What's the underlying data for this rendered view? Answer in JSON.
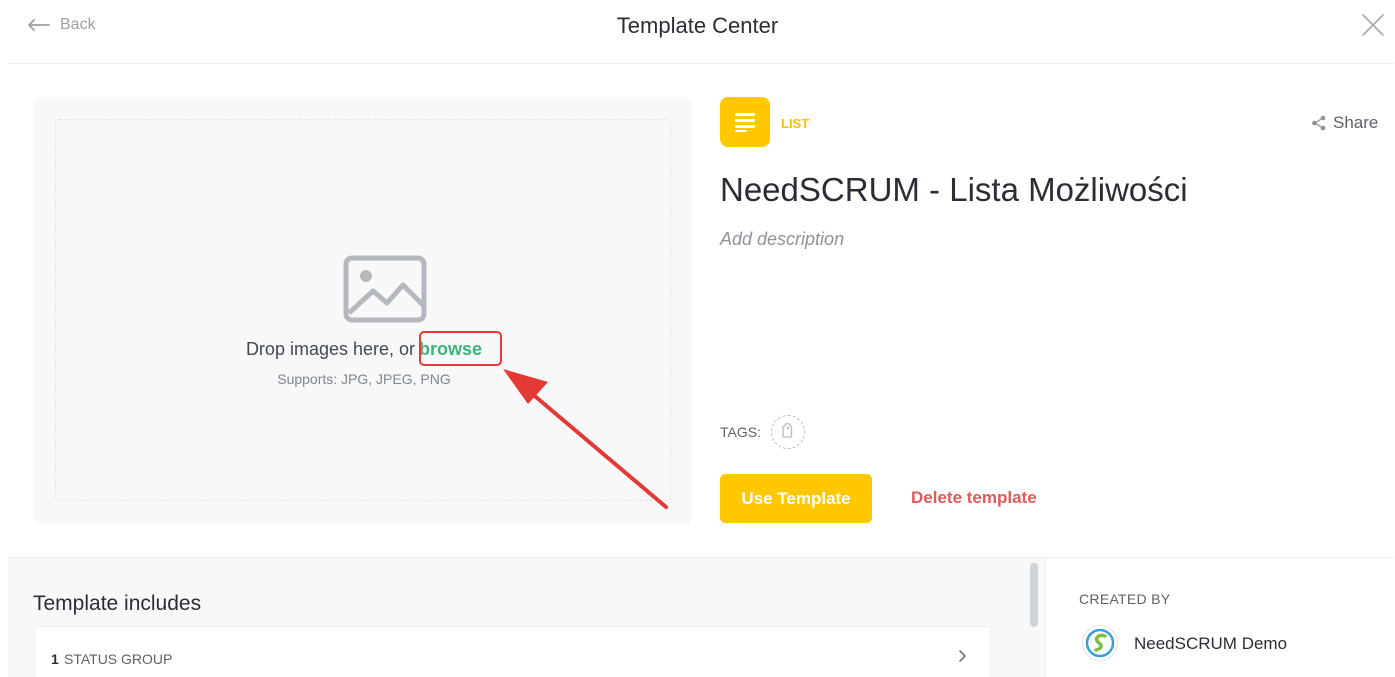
{
  "header": {
    "back_label": "Back",
    "title": "Template Center"
  },
  "dropzone": {
    "prompt": "Drop images here, or",
    "browse_label": "browse",
    "supports": "Supports: JPG, JPEG, PNG"
  },
  "template": {
    "type_label": "LIST",
    "name": "NeedSCRUM - Lista Możliwości",
    "description_placeholder": "Add description",
    "share_label": "Share",
    "tags_label": "TAGS:"
  },
  "actions": {
    "use_label": "Use Template",
    "delete_label": "Delete template"
  },
  "includes": {
    "title": "Template includes",
    "items": [
      {
        "count": "1",
        "label": "STATUS GROUP"
      }
    ]
  },
  "creator": {
    "label": "CREATED BY",
    "name": "NeedSCRUM Demo"
  },
  "colors": {
    "accent": "#ffc800",
    "browse": "#3fb47b",
    "delete": "#e05a5a",
    "highlight": "#e53935"
  },
  "icons": {
    "back": "arrow-left-icon",
    "close": "close-icon",
    "image": "image-icon",
    "list_type": "list-icon",
    "share": "share-icon",
    "tag": "tag-icon",
    "chevron": "chevron-right-icon",
    "avatar": "creator-logo"
  }
}
